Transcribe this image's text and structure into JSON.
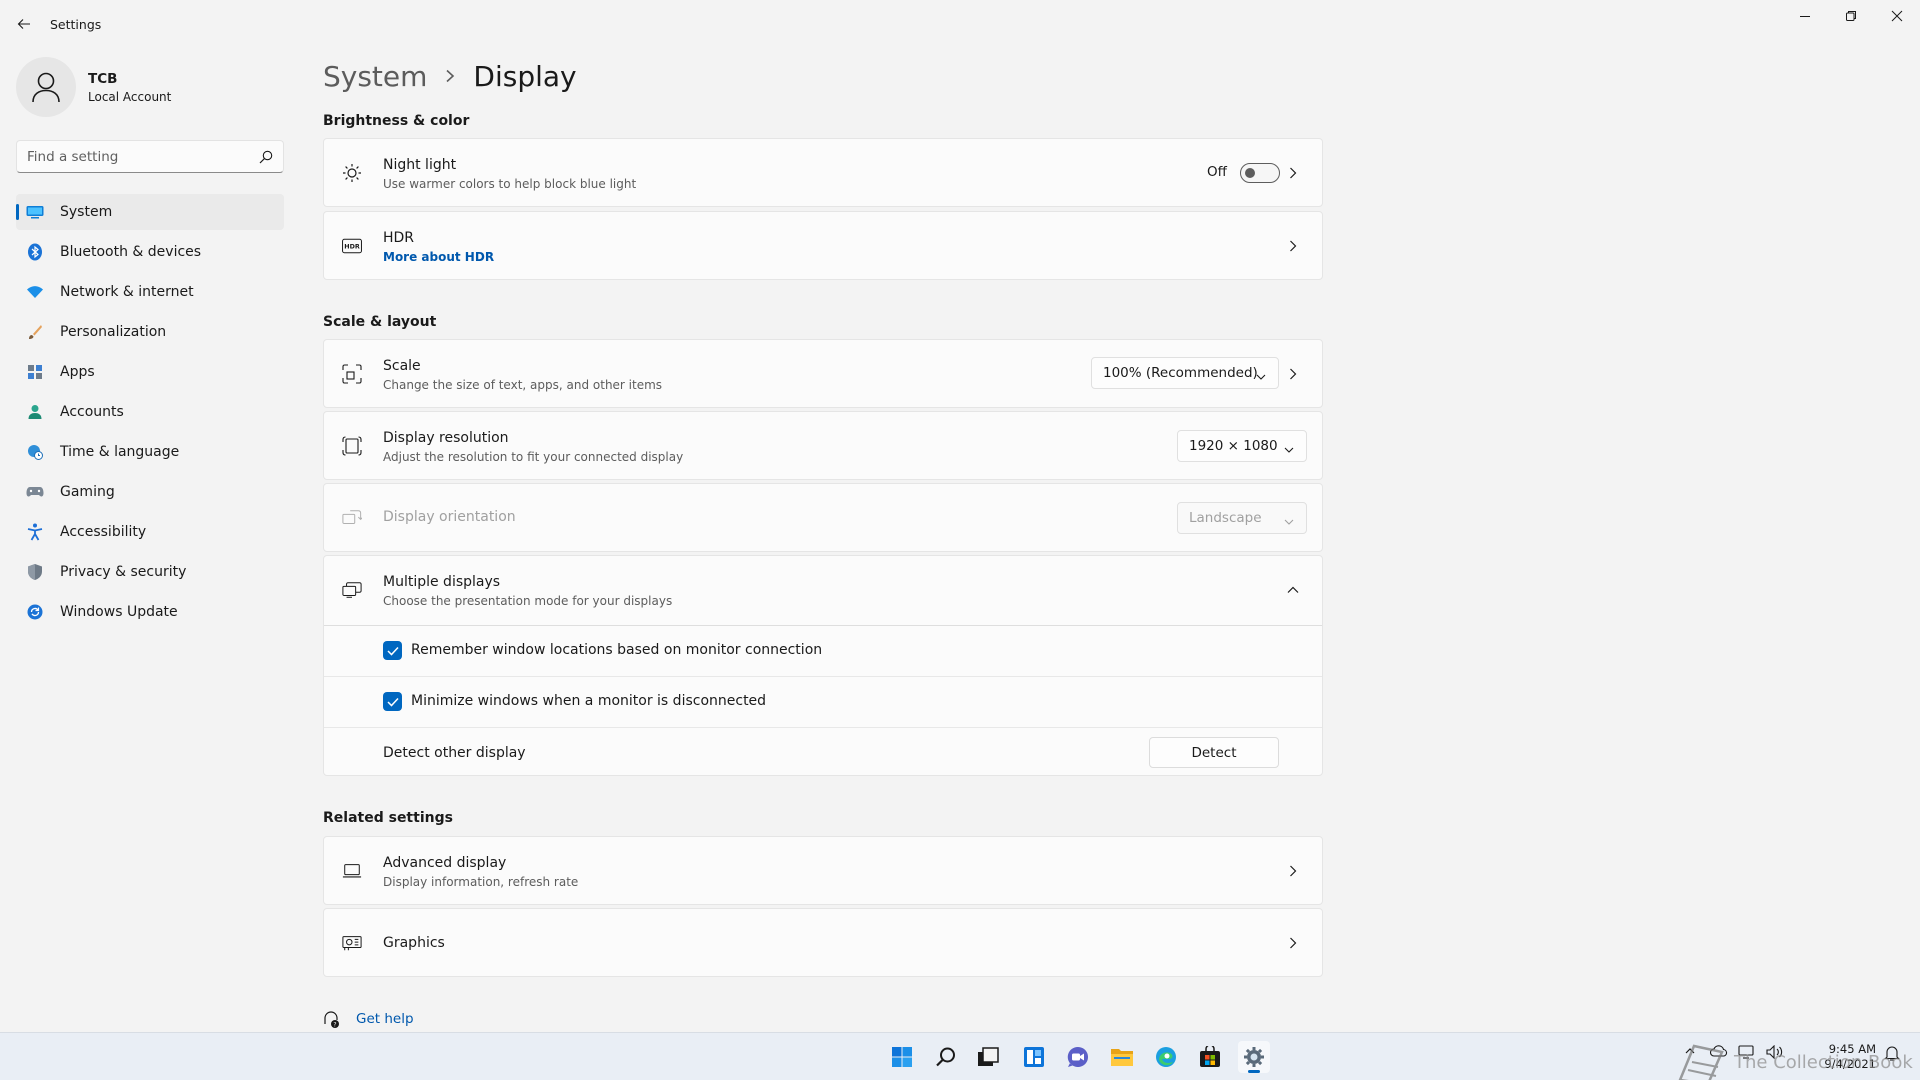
{
  "app": {
    "title": "Settings"
  },
  "profile": {
    "name": "TCB",
    "account_type": "Local Account"
  },
  "search": {
    "placeholder": "Find a setting"
  },
  "nav": {
    "items": [
      {
        "label": "System",
        "icon": "monitor-icon",
        "active": true
      },
      {
        "label": "Bluetooth & devices",
        "icon": "bluetooth-icon"
      },
      {
        "label": "Network & internet",
        "icon": "wifi-icon"
      },
      {
        "label": "Personalization",
        "icon": "brush-icon"
      },
      {
        "label": "Apps",
        "icon": "apps-icon"
      },
      {
        "label": "Accounts",
        "icon": "person-icon"
      },
      {
        "label": "Time & language",
        "icon": "globe-clock-icon"
      },
      {
        "label": "Gaming",
        "icon": "gamepad-icon"
      },
      {
        "label": "Accessibility",
        "icon": "accessibility-icon"
      },
      {
        "label": "Privacy & security",
        "icon": "shield-icon"
      },
      {
        "label": "Windows Update",
        "icon": "update-icon"
      }
    ]
  },
  "breadcrumb": {
    "parent": "System",
    "current": "Display"
  },
  "sections": {
    "brightness": "Brightness & color",
    "scale_layout": "Scale & layout",
    "related": "Related settings"
  },
  "night_light": {
    "title": "Night light",
    "subtitle": "Use warmer colors to help block blue light",
    "state_label": "Off",
    "on": false
  },
  "hdr": {
    "title": "HDR",
    "link": "More about HDR"
  },
  "scale": {
    "title": "Scale",
    "subtitle": "Change the size of text, apps, and other items",
    "value": "100% (Recommended)"
  },
  "resolution": {
    "title": "Display resolution",
    "subtitle": "Adjust the resolution to fit your connected display",
    "value": "1920 × 1080"
  },
  "orientation": {
    "title": "Display orientation",
    "value": "Landscape",
    "disabled": true
  },
  "multiple_displays": {
    "title": "Multiple displays",
    "subtitle": "Choose the presentation mode for your displays",
    "expanded": true,
    "remember_label": "Remember window locations based on monitor connection",
    "remember_checked": true,
    "minimize_label": "Minimize windows when a monitor is disconnected",
    "minimize_checked": true,
    "detect_label": "Detect other display",
    "detect_button": "Detect"
  },
  "advanced_display": {
    "title": "Advanced display",
    "subtitle": "Display information, refresh rate"
  },
  "graphics": {
    "title": "Graphics"
  },
  "help": {
    "label": "Get help"
  },
  "taskbar": {
    "icons": [
      "start-icon",
      "search-icon",
      "task-view-icon",
      "widgets-icon",
      "chat-icon",
      "file-explorer-icon",
      "edge-icon",
      "store-icon",
      "settings-icon"
    ],
    "time": "9:45 AM",
    "date": "9/4/2021"
  },
  "watermark": {
    "text": "The Collection Book"
  },
  "colors": {
    "accent": "#0067c0",
    "link": "#0058ad",
    "background": "#f3f3f3",
    "card": "#fbfbfb"
  }
}
